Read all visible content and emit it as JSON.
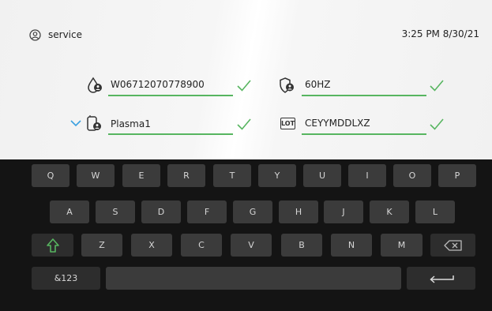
{
  "header": {
    "user_name": "service",
    "datetime": "3:25 PM 8/30/21"
  },
  "fields": {
    "din": {
      "value": "W06712070778900",
      "icon": "drop-id-icon"
    },
    "frequency": {
      "value": "60HZ",
      "icon": "shield-id-icon"
    },
    "product": {
      "value": "Plasma1",
      "icon": "bag-id-icon"
    },
    "lot": {
      "value": "CEYYMDDLXZ",
      "icon": "lot-icon",
      "icon_label": "LOT"
    }
  },
  "keyboard": {
    "row1": [
      "Q",
      "W",
      "E",
      "R",
      "T",
      "Y",
      "U",
      "I",
      "O",
      "P"
    ],
    "row2": [
      "A",
      "S",
      "D",
      "F",
      "G",
      "H",
      "J",
      "K",
      "L"
    ],
    "row3": [
      "Z",
      "X",
      "C",
      "V",
      "B",
      "N",
      "M"
    ],
    "numbers_label": "&123"
  },
  "colors": {
    "accent_green": "#57b560",
    "accent_blue": "#3aa0e0",
    "keyboard_bg": "#141414",
    "key_bg": "#3b3b3b"
  }
}
